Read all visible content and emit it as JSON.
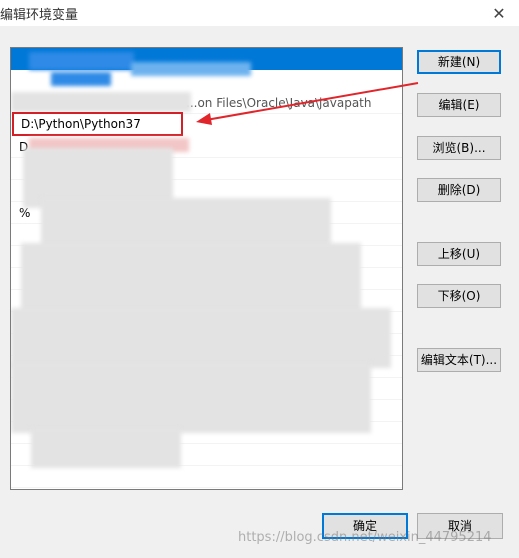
{
  "window": {
    "title": "编辑环境变量",
    "close_glyph": "✕"
  },
  "list": {
    "partial_row_text": "...on Files\\Oracle\\Java\\javapath",
    "editing_value": "D:\\Python\\Python37",
    "row_d_prefix": "D",
    "row_percent_prefix": "%"
  },
  "buttons": {
    "new": "新建(N)",
    "edit": "编辑(E)",
    "browse": "浏览(B)...",
    "delete": "删除(D)",
    "move_up": "上移(U)",
    "move_down": "下移(O)",
    "edit_text": "编辑文本(T)..."
  },
  "footer": {
    "ok": "确定",
    "cancel": "取消"
  },
  "watermark": "https://blog.csdn.net/weixin_44795214",
  "colors": {
    "selection": "#0078d7",
    "highlight_box": "#d32027",
    "arrow": "#e0252b"
  }
}
